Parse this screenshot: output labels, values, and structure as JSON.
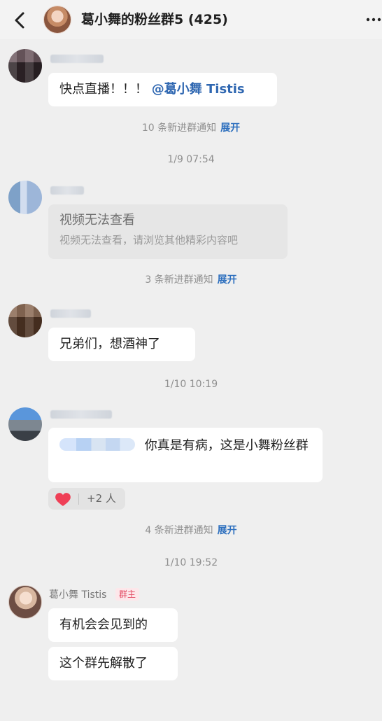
{
  "header": {
    "title": "葛小舞的粉丝群5 (425)"
  },
  "messages": [
    {
      "text_prefix": "快点直播！！！",
      "mention": "@葛小舞 Tistis"
    },
    {
      "title": "视频无法查看",
      "subtitle": "视频无法查看，请浏览其他精彩内容吧"
    },
    {
      "text": "兄弟们，想酒神了"
    },
    {
      "text": "你真是有病，这是小舞粉丝群"
    },
    {
      "text": "有机会会见到的"
    },
    {
      "text": "这个群先解散了"
    }
  ],
  "notices": [
    {
      "text": "10 条新进群通知",
      "action": "展开"
    },
    {
      "text": "3 条新进群通知",
      "action": "展开"
    },
    {
      "text": "4 条新进群通知",
      "action": "展开"
    }
  ],
  "timestamps": [
    "1/9 07:54",
    "1/10 10:19",
    "1/10 19:52"
  ],
  "reaction": {
    "count": "+2 人",
    "icon": "heart-icon",
    "color": "#ef3f56"
  },
  "sender": {
    "name": "葛小舞 Tistis",
    "role": "群主"
  },
  "colors": {
    "accent": "#2d6fbe",
    "mention": "#2f67b1",
    "owner_badge": "#e24a62"
  }
}
